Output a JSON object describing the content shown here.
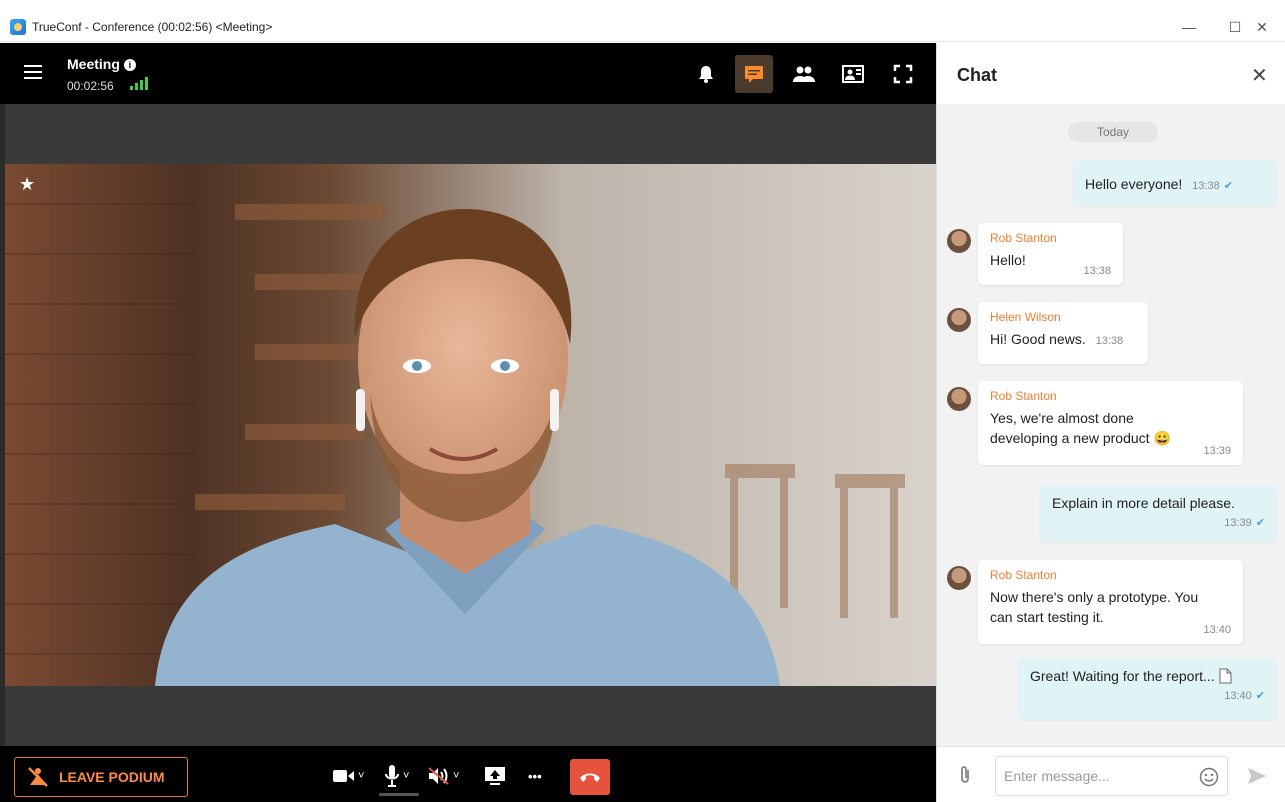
{
  "window": {
    "title": "TrueConf - Conference (00:02:56) <Meeting>",
    "minimize": "—",
    "maximize": "☐",
    "close": "✕"
  },
  "conference": {
    "meeting_name": "Meeting",
    "info_glyph": "i",
    "elapsed": "00:02:56",
    "topbar_icons": [
      "menu-icon",
      "bell-icon",
      "chat-icon",
      "participants-icon",
      "layout-icon",
      "fullscreen-icon"
    ],
    "active_icon": "chat-icon",
    "star_glyph": "★"
  },
  "bottombar": {
    "leave_podium_label": "LEAVE PODIUM",
    "controls": [
      "camera-icon",
      "microphone-icon",
      "speaker-mute-icon",
      "screen-share-icon",
      "more-icon",
      "hangup-icon"
    ],
    "more_glyph": "•••",
    "caret": "˅",
    "hangup_color": "#e5533f",
    "accent_color": "#ff8a45"
  },
  "chat": {
    "title": "Chat",
    "close_glyph": "✕",
    "date_separator": "Today",
    "check_glyph": "✔",
    "messages": [
      {
        "direction": "out",
        "text": "Hello everyone!",
        "time": "13:38",
        "read": true
      },
      {
        "direction": "in",
        "sender": "Rob Stanton",
        "text": "Hello!",
        "time": "13:38"
      },
      {
        "direction": "in",
        "sender": "Helen Wilson",
        "text": "Hi! Good news.",
        "time": "13:38"
      },
      {
        "direction": "in",
        "sender": "Rob Stanton",
        "text": "Yes, we're almost done developing a new product 😀",
        "time": "13:39"
      },
      {
        "direction": "out",
        "text": "Explain in more detail please.",
        "time": "13:39",
        "read": true
      },
      {
        "direction": "in",
        "sender": "Rob Stanton",
        "text": "Now there's only a prototype. You can start testing it.",
        "time": "13:40"
      },
      {
        "direction": "out",
        "text": "Great! Waiting for the report...",
        "attachment_icon": "document-icon",
        "time": "13:40",
        "read": true
      }
    ],
    "input_placeholder": "Enter message...",
    "sender_color": "#f07c30",
    "outgoing_bubble_color": "#e0f4f6"
  }
}
